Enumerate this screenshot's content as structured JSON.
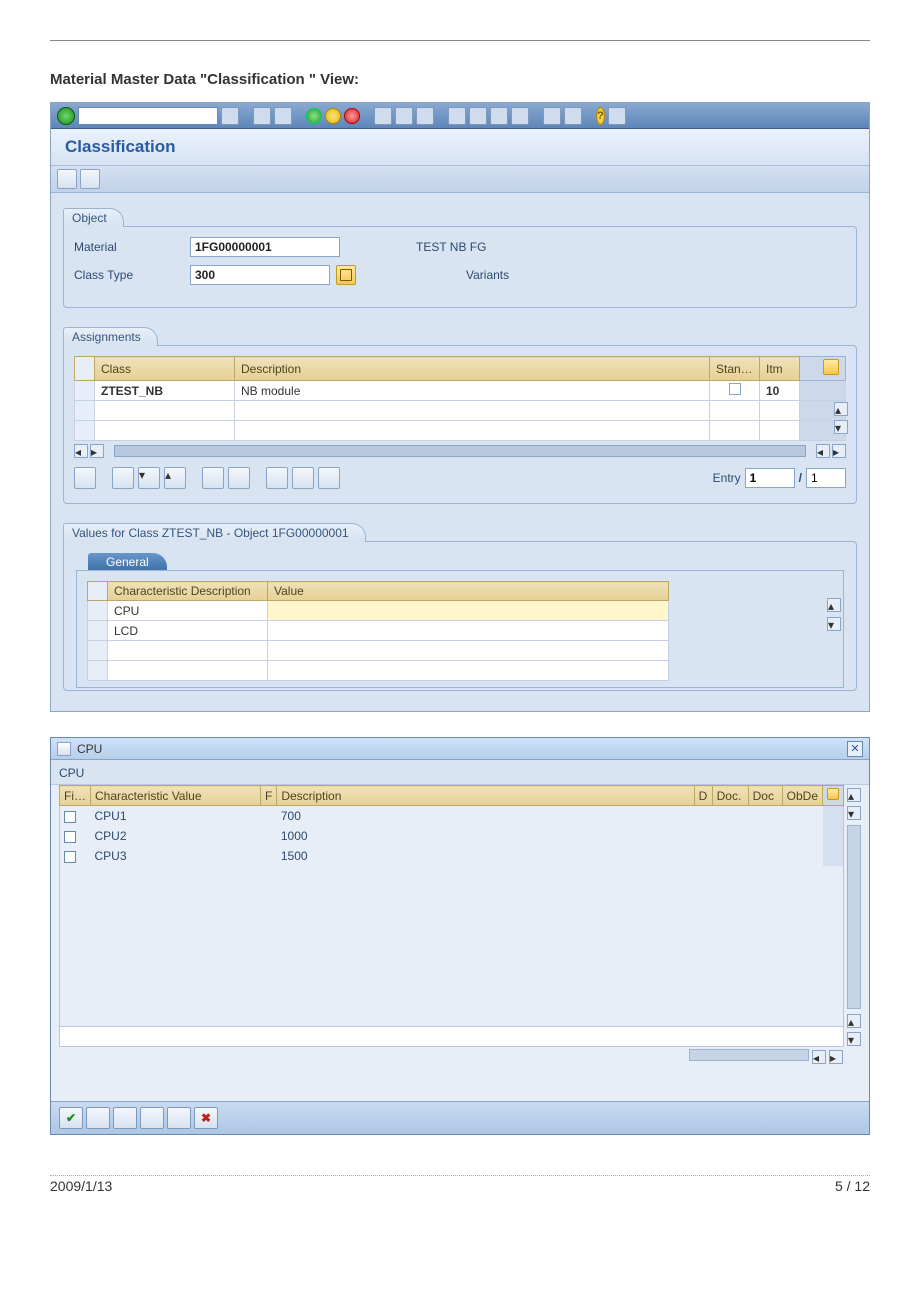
{
  "doc": {
    "heading": "Material Master Data \"Classification \" View:",
    "date": "2009/1/13",
    "page": "5 / 12"
  },
  "main": {
    "title": "Classification",
    "object": {
      "tab_label": "Object",
      "material_label": "Material",
      "material_value": "1FG00000001",
      "material_desc": "TEST NB FG",
      "classtype_label": "Class Type",
      "classtype_value": "300",
      "classtype_desc": "Variants"
    },
    "assignments": {
      "tab_label": "Assignments",
      "cols": {
        "class": "Class",
        "desc": "Description",
        "stan": "Stan…",
        "itm": "Itm"
      },
      "rows": [
        {
          "class": "ZTEST_NB",
          "desc": "NB module",
          "stan": "",
          "itm": "10"
        }
      ],
      "entry_label": "Entry",
      "entry_current": "1",
      "entry_sep": "/",
      "entry_total": "1"
    },
    "values": {
      "panel_title": "Values for Class ZTEST_NB - Object 1FG00000001",
      "tab_label": "General",
      "cols": {
        "char_desc": "Characteristic Description",
        "value": "Value"
      },
      "rows": [
        {
          "char_desc": "CPU",
          "value": ""
        },
        {
          "char_desc": "LCD",
          "value": ""
        }
      ]
    }
  },
  "popup": {
    "title": "CPU",
    "subtitle": "CPU",
    "cols": {
      "fi": "Fi…",
      "charval": "Characteristic Value",
      "f": "F",
      "desc": "Description",
      "d": "D",
      "doc1": "Doc.",
      "doc2": "Doc",
      "obde": "ObDe"
    },
    "rows": [
      {
        "val": "CPU1",
        "desc": "700"
      },
      {
        "val": "CPU2",
        "desc": "1000"
      },
      {
        "val": "CPU3",
        "desc": "1500"
      }
    ]
  }
}
